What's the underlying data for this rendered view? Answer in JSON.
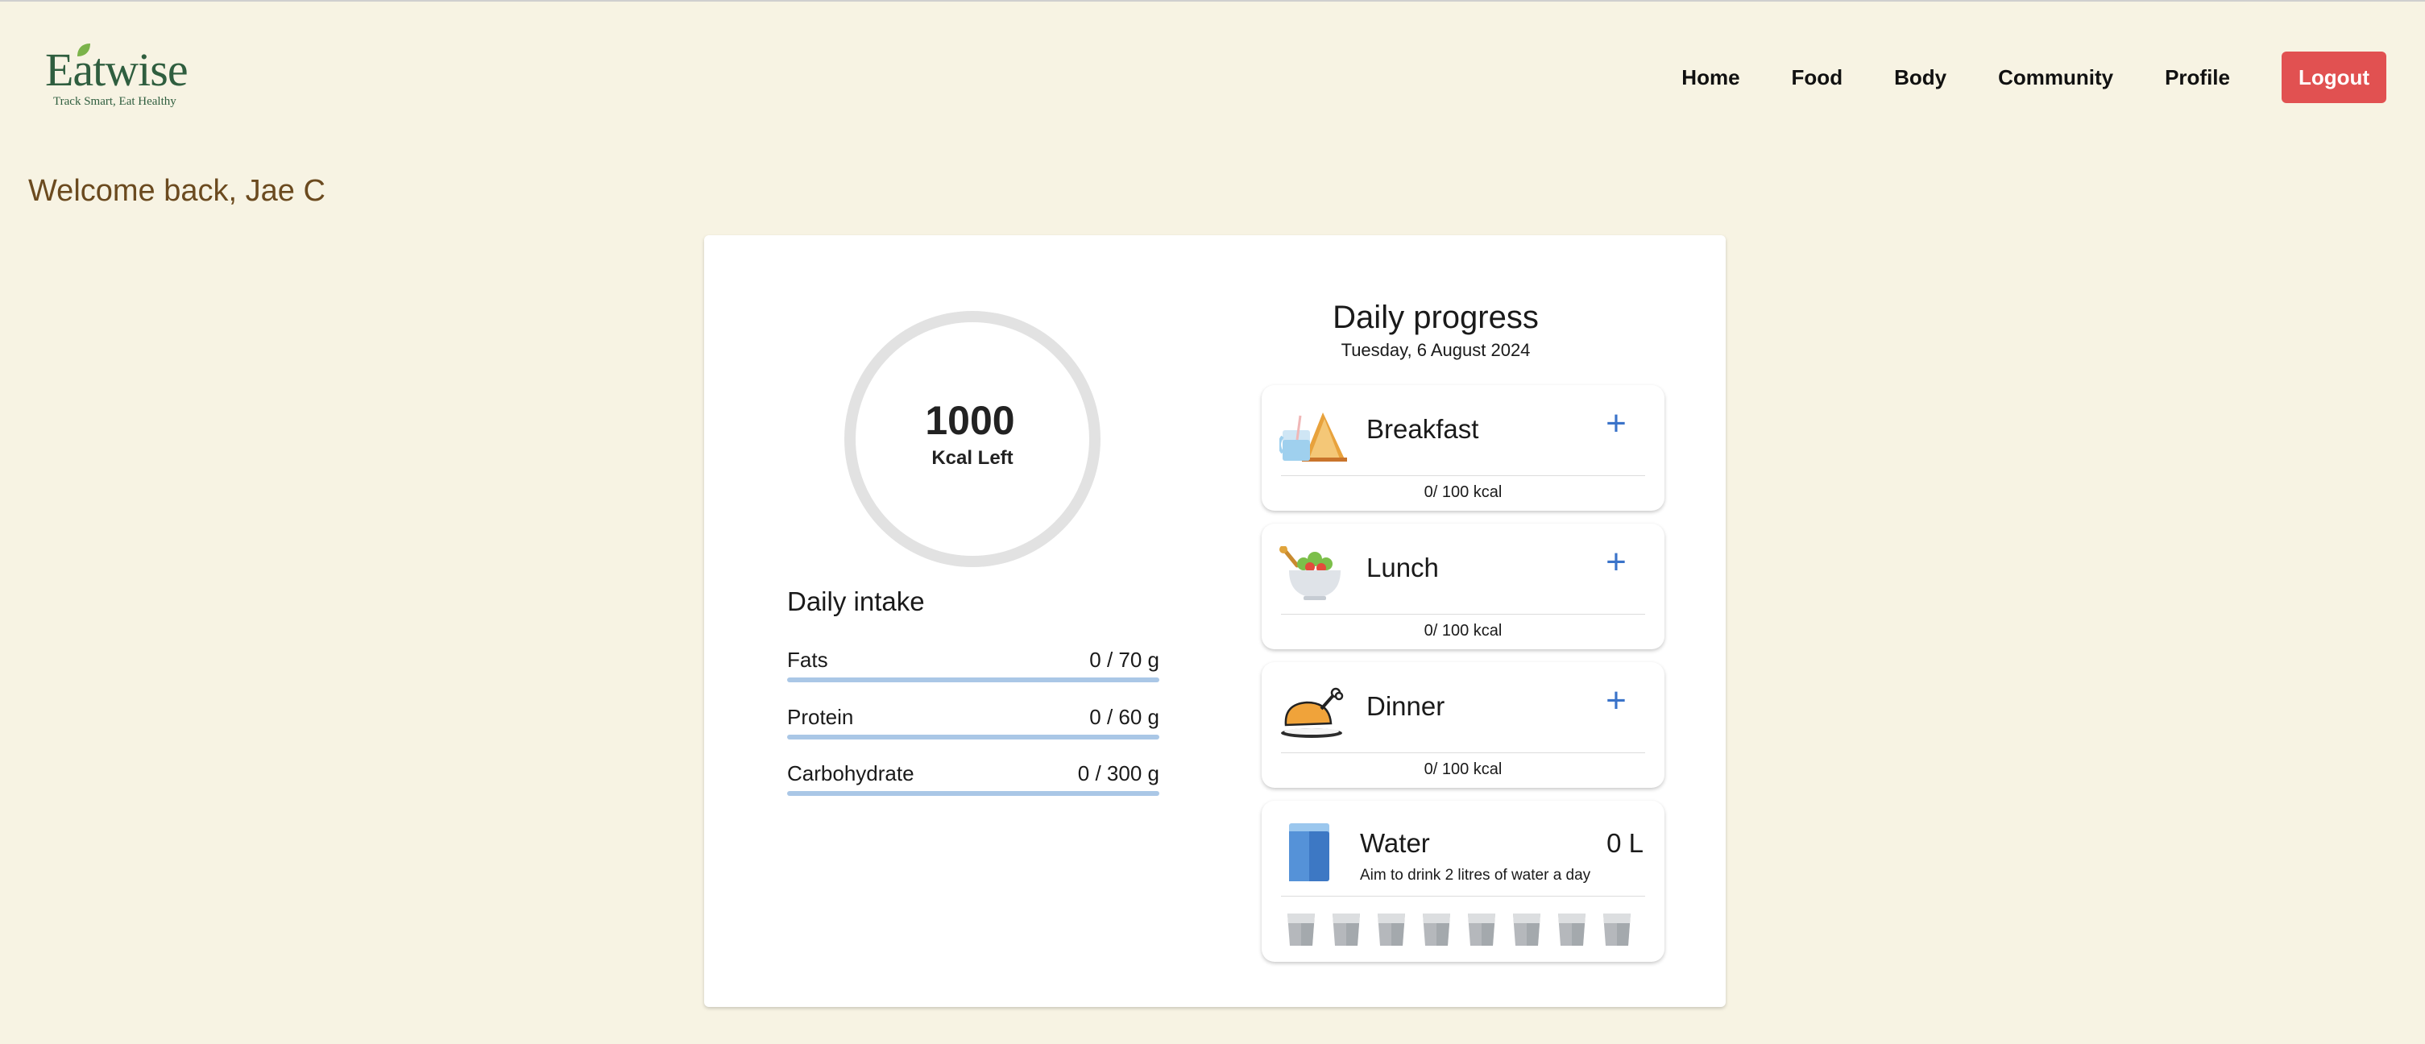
{
  "brand": {
    "name": "Eatwise",
    "tagline": "Track Smart, Eat Healthy",
    "color": "#2f5e3f"
  },
  "nav": {
    "items": [
      "Home",
      "Food",
      "Body",
      "Community",
      "Profile"
    ],
    "logout_label": "Logout",
    "logout_color": "#e15151"
  },
  "welcome": "Welcome back, Jae C",
  "calories": {
    "value": "1000",
    "label": "Kcal Left",
    "progress": 0
  },
  "intake": {
    "title": "Daily intake",
    "macros": [
      {
        "name": "Fats",
        "value": "0 / 70 g",
        "progress": 0
      },
      {
        "name": "Protein",
        "value": "0 / 60 g",
        "progress": 0
      },
      {
        "name": "Carbohydrate",
        "value": "0 / 300 g",
        "progress": 0
      }
    ]
  },
  "progress": {
    "title": "Daily progress",
    "date": "Tuesday, 6 August 2024"
  },
  "meals": [
    {
      "name": "Breakfast",
      "kcal": "0/ 100 kcal",
      "icon": "breakfast-icon"
    },
    {
      "name": "Lunch",
      "kcal": "0/ 100 kcal",
      "icon": "lunch-icon"
    },
    {
      "name": "Dinner",
      "kcal": "0/ 100 kcal",
      "icon": "dinner-icon"
    }
  ],
  "add_symbol": "+",
  "water": {
    "title": "Water",
    "amount": "0 L",
    "hint": "Aim to drink 2 litres of water a day",
    "glasses_filled": 0,
    "glasses_total": 8
  }
}
